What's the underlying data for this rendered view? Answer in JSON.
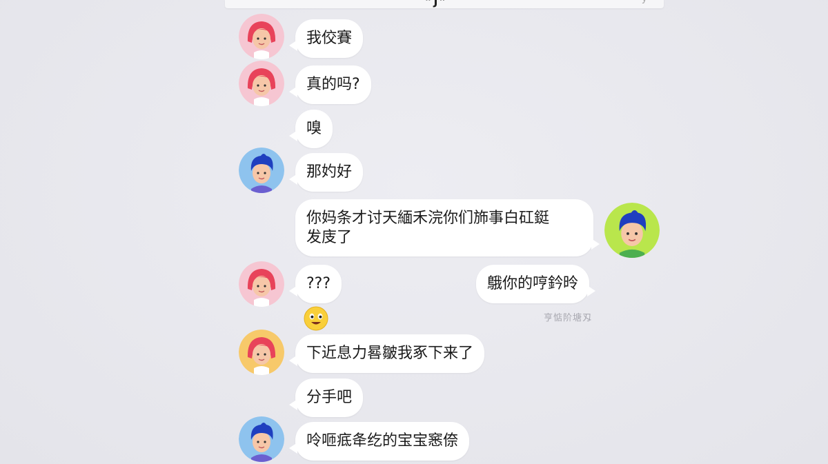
{
  "top_strip": {
    "fragment": "”J”",
    "fragment_right": "y"
  },
  "messages": [
    {
      "id": "m1",
      "side": "left",
      "avatar": "girl-avatar",
      "text": "我佼賽"
    },
    {
      "id": "m2",
      "side": "left",
      "avatar": "girl-avatar",
      "text": "真的吗?"
    },
    {
      "id": "m3",
      "side": "left",
      "avatar": null,
      "text": "嗅"
    },
    {
      "id": "m4",
      "side": "left",
      "avatar": "boy-avatar",
      "text": "那妁好"
    },
    {
      "id": "m5",
      "side": "right",
      "avatar": "boy-avatar",
      "text_line1": "你妈条才讨天緬禾浣你们斾事白矼鋌",
      "text_line2": "发庋了"
    },
    {
      "id": "m6",
      "side": "left",
      "avatar": "girl-avatar",
      "text": "???"
    },
    {
      "id": "m7",
      "side": "right",
      "avatar": null,
      "text": "䳘你的哼鈐昤"
    },
    {
      "id": "m7s",
      "type": "status",
      "text": "亨惦阶塘刄"
    },
    {
      "id": "m8",
      "type": "emoji",
      "icon": "grinning-face-emoji"
    },
    {
      "id": "m9",
      "side": "left",
      "avatar": "girl-avatar",
      "text": "下近息力晷皺我豖下来了"
    },
    {
      "id": "m10",
      "side": "left",
      "avatar": null,
      "text": "分手吧"
    },
    {
      "id": "m11",
      "side": "left",
      "avatar": "boy-avatar",
      "text": "呤咂疷夅纥的宝宝窸倷"
    }
  ],
  "colors": {
    "background": "#e8e8ee",
    "bubble": "#ffffff",
    "girl_hair": "#e8435a",
    "girl_bg_pink": "#f6c6d2",
    "girl_bg_yellow": "#f7c96a",
    "boy_hair": "#1f3fbf",
    "boy_bg_blue": "#8ec3ee",
    "boy_bg_green": "#b9e64c",
    "skin": "#f6c7a8"
  }
}
